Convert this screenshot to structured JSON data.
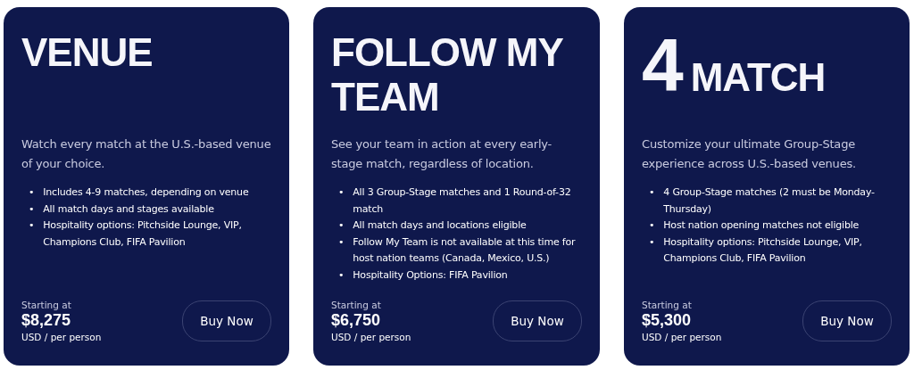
{
  "cards": [
    {
      "title": "VENUE",
      "description": "Watch every match at the U.S.-based venue of your choice.",
      "features": [
        {
          "marker": "•",
          "text": "Includes 4-9 matches, depending on venue"
        },
        {
          "marker": "•",
          "text": "All match days and stages available"
        },
        {
          "marker": "•",
          "text": "Hospitality options: Pitchside Lounge, VIP, Champions Club, FIFA Pavilion"
        }
      ],
      "price_label": "Starting at",
      "price": "$8,275",
      "price_unit": "USD / per person",
      "button": "Buy Now"
    },
    {
      "title": "FOLLOW MY TEAM",
      "description": "See your team in action at every early-stage match, regardless of location.",
      "features": [
        {
          "marker": "•",
          "text": "All 3 Group-Stage matches and 1 Round-of-32 match"
        },
        {
          "marker": "•",
          "text": "All match days and locations eligible"
        },
        {
          "marker": "•",
          "text": "Follow My Team is not available at this time for host nation teams (Canada, Mexico, U.S.)"
        },
        {
          "marker": "•",
          "text": "Hospitality Options: FIFA Pavilion"
        }
      ],
      "price_label": "Starting at",
      "price": "$6,750",
      "price_unit": "USD / per person",
      "button": "Buy Now"
    },
    {
      "title_lead": "4",
      "title": "MATCH",
      "description": "Customize your ultimate Group-Stage experience across U.S.-based venues.",
      "features": [
        {
          "marker": "•",
          "text": "4 Group-Stage matches (2 must be Monday-Thursday)"
        },
        {
          "marker": "•",
          "text": "Host nation opening matches not eligible"
        },
        {
          "marker": "•",
          "text": "Hospitality options: Pitchside Lounge, VIP, Champions Club, FIFA Pavilion"
        }
      ],
      "price_label": "Starting at",
      "price": "$5,300",
      "price_unit": "USD / per person",
      "button": "Buy Now"
    }
  ]
}
